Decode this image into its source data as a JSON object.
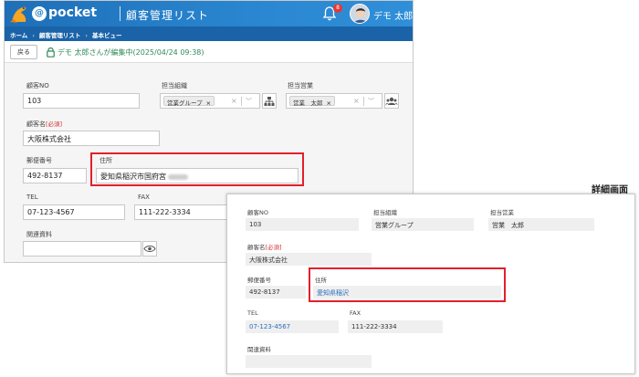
{
  "header": {
    "brand": "pocket",
    "brand_at": "@",
    "app_title": "顧客管理リスト",
    "notification_count": "8",
    "user_name": "デモ 太郎"
  },
  "breadcrumb": [
    "ホーム",
    "顧客管理リスト",
    "基本ビュー"
  ],
  "actionbar": {
    "back_label": "戻る",
    "lock_message": "デモ 太郎さんが編集中(2025/04/24 09:38)"
  },
  "edit_form": {
    "customer_no": {
      "label": "顧客NO",
      "value": "103"
    },
    "org": {
      "label": "担当組織",
      "chip": "営業グループ",
      "remove": "×",
      "clear": "×",
      "arrow": "﹀"
    },
    "sales": {
      "label": "担当営業",
      "chip": "営業　太郎",
      "remove": "×",
      "clear": "×",
      "arrow": "﹀"
    },
    "customer_name": {
      "label": "顧客名",
      "required": "[必須]",
      "value": "大阪株式会社"
    },
    "postal": {
      "label": "郵便番号",
      "value": "492-8137"
    },
    "address": {
      "label": "住所",
      "value": "愛知県稲沢市国府宮"
    },
    "tel": {
      "label": "TEL",
      "value": "07-123-4567"
    },
    "fax": {
      "label": "FAX",
      "value": "111-222-3334"
    },
    "related": {
      "label": "関連資料",
      "value": ""
    }
  },
  "detail": {
    "title": "詳細画面",
    "customer_no": {
      "label": "顧客NO",
      "value": "103"
    },
    "org": {
      "label": "担当組織",
      "value": "営業グループ"
    },
    "sales": {
      "label": "担当営業",
      "value": "営業　太郎"
    },
    "customer_name": {
      "label": "顧客名",
      "required": "[必須]",
      "value": "大阪株式会社"
    },
    "postal": {
      "label": "郵便番号",
      "value": "492-8137"
    },
    "address": {
      "label": "住所",
      "value": "愛知県稲沢"
    },
    "tel": {
      "label": "TEL",
      "value": "07-123-4567"
    },
    "fax": {
      "label": "FAX",
      "value": "111-222-3334"
    },
    "related": {
      "label": "関連資料",
      "value": ""
    }
  },
  "colors": {
    "header_blue": "#2a86d0",
    "breadcrumb_blue": "#1a63a8",
    "lock_green": "#2e8b57",
    "highlight_red": "#e2202a",
    "link_blue": "#2a6ebd"
  }
}
